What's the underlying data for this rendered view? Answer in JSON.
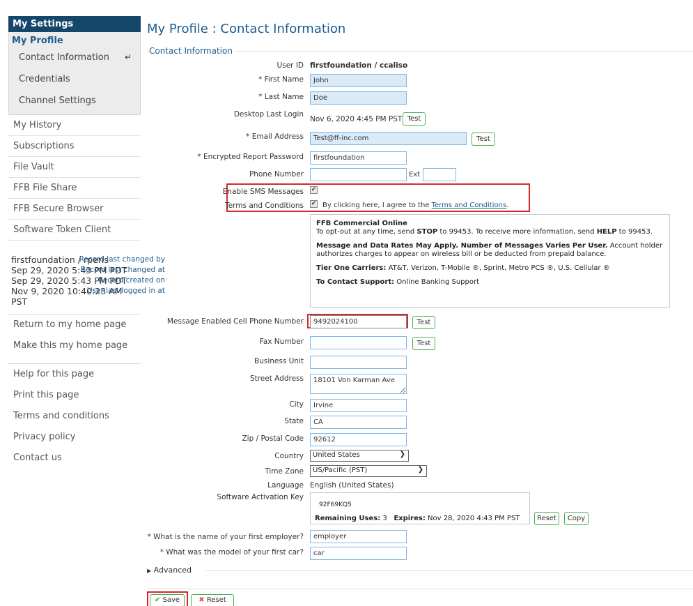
{
  "sidebar": {
    "header": "My Settings",
    "profile_title": "My Profile",
    "profile_items": [
      "Contact Information",
      "Credentials",
      "Channel Settings"
    ],
    "active_marker": "↵",
    "items": [
      "My History",
      "Subscriptions",
      "File Vault",
      "FFB File Share",
      "FFB Secure Browser",
      "Software Token Client"
    ],
    "meta": [
      {
        "label": "Record last changed by",
        "value": "firstfoundation / rperis"
      },
      {
        "label": "Record last changed at",
        "value": "Sep 29, 2020 5:43 PM PDT"
      },
      {
        "label": "Record created on",
        "value": "Sep 29, 2020 5:43 PM PDT"
      },
      {
        "label": "User last logged in at",
        "value": "Nov 9, 2020 10:40:23 AM PST"
      }
    ],
    "home_links": [
      "Return to my home page",
      "Make this my home page"
    ],
    "help_links": [
      "Help for this page",
      "Print this page",
      "Terms and conditions",
      "Privacy policy",
      "Contact us"
    ]
  },
  "main": {
    "title": "My Profile : Contact Information",
    "legend": "Contact Information",
    "user_id_label": "User ID",
    "user_id_value": "firstfoundation / ccaliso",
    "first_name_label": "* First Name",
    "first_name_value": "John",
    "last_name_label": "* Last Name",
    "last_name_value": "Doe",
    "desktop_login_label": "Desktop Last Login",
    "desktop_login_value": "Nov 6, 2020 4:45 PM PST",
    "test_label": "Test",
    "email_label": "* Email Address",
    "email_value": "Test@ff-inc.com",
    "report_pw_label": "* Encrypted Report Password",
    "report_pw_value": "firstfoundation",
    "phone_label": "Phone Number",
    "phone_value": "",
    "ext_label": "Ext",
    "ext_value": "",
    "sms_label": "Enable SMS Messages",
    "terms_label": "Terms and Conditions",
    "terms_text": "By clicking here, I agree to the",
    "terms_link": "Terms and Conditions",
    "terms_period": ".",
    "sms_box": {
      "heading": "FFB Commercial Online",
      "optout_1": "To opt-out at any time, send",
      "stop": "STOP",
      "optout_2": "to 99453. To receive more information, send",
      "help": "HELP",
      "optout_3": "to 99453.",
      "rates_bold": "Message and Data Rates May Apply. Number of Messages Varies Per User.",
      "rates_rest": "Account holder authorizes charges to appear on wireless bill or be deducted from prepaid balance.",
      "carriers_bold": "Tier One Carriers:",
      "carriers_rest": "AT&T, Verizon, T-Mobile ®, Sprint, Metro PCS ®, U.S. Cellular ®",
      "support_bold": "To Contact Support:",
      "support_rest": "Online Banking Support"
    },
    "cell_label": "Message Enabled Cell Phone Number",
    "cell_value": "9492024100",
    "fax_label": "Fax Number",
    "fax_value": "",
    "business_unit_label": "Business Unit",
    "business_unit_value": "",
    "street_label": "Street Address",
    "street_value": "18101 Von Karman Ave",
    "city_label": "City",
    "city_value": "Irvine",
    "state_label": "State",
    "state_value": "CA",
    "zip_label": "Zip / Postal Code",
    "zip_value": "92612",
    "country_label": "Country",
    "country_value": "United States",
    "timezone_label": "Time Zone",
    "timezone_value": "US/Pacific (PST)",
    "language_label": "Language",
    "language_value": "English (United States)",
    "activation_label": "Software Activation Key",
    "activation_key": "92F69KQ5",
    "remaining_label": "Remaining Uses:",
    "remaining_value": "3",
    "expires_label": "Expires:",
    "expires_value": "Nov 28, 2020 4:43 PM PST",
    "reset_label": "Reset",
    "copy_label": "Copy",
    "employer_label": "* What is the name of your first employer?",
    "employer_value": "employer",
    "car_label": "* What was the model of your first car?",
    "car_value": "car",
    "advanced_label": "Advanced",
    "save_label": "Save",
    "reset_form_label": "Reset"
  },
  "colors": {
    "sidebar_header": "#15476b",
    "title_blue": "#1d5c8e",
    "highlight_red": "#d42a2a",
    "button_green": "#4caf50",
    "input_border": "#7fb8e6"
  }
}
